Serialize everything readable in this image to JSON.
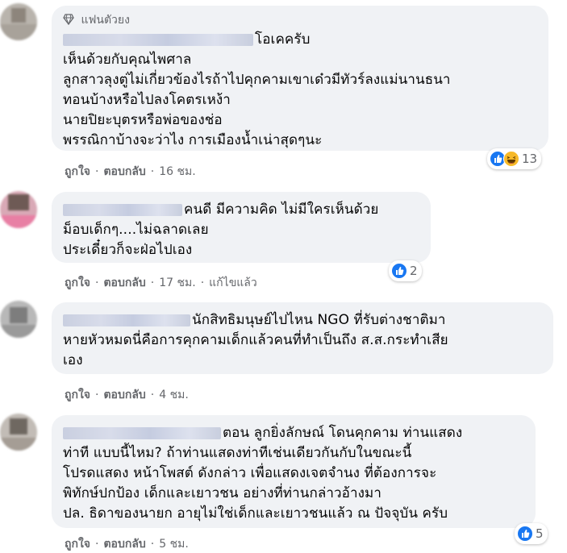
{
  "comments": [
    {
      "badge": "แฟนตัวยง",
      "lines": [
        "โอเคครับ",
        "เห็นด้วยกับคุณไพศาล",
        "ลูกสาวลุงตู่ไม่เกี่ยวข้องไรถ้าไปคุกคามเขาเด๋วมีทัวร์ลงแม่นานธนา",
        "ทอนบ้างหรือไปลงโคตรเหง้า",
        "นายปิยะบุตรหรือพ่อของช่อ",
        "พรรณิกาบ้างจะว่าไง การเมืองน้ำเน่าสุดๆนะ"
      ],
      "actions": {
        "like": "ถูกใจ",
        "reply": "ตอบกลับ",
        "time": "16 ชม."
      },
      "reactions": {
        "icons": [
          "like-icon",
          "haha-icon"
        ],
        "count": "13"
      }
    },
    {
      "lines": [
        "คนดี มีความคิด ไม่มีใครเห็นด้วย",
        "ม็อบเด็กๆ....ไม่ฉลาดเลย",
        "ประเดี๋ยวก็จะฝ่อไปเอง"
      ],
      "actions": {
        "like": "ถูกใจ",
        "reply": "ตอบกลับ",
        "time": "17 ชม.",
        "edited": "แก้ไขแล้ว"
      },
      "reactions": {
        "icons": [
          "like-icon"
        ],
        "count": "2"
      }
    },
    {
      "lines": [
        "นักสิทธิมนุษย์ไปไหน NGO ที่รับต่างชาติมา",
        "หายหัวหมดนี่คือการคุกคามเด็กแล้วคนที่ทำเป็นถึง ส.ส.กระทำเสีย",
        "เอง"
      ],
      "actions": {
        "like": "ถูกใจ",
        "reply": "ตอบกลับ",
        "time": "4 ชม."
      }
    },
    {
      "lines": [
        "ตอน ลูกยิ่งลักษณ์ โดนคุกคาม ท่านแสดง",
        "ท่าที แบบนี้ไหม? ถ้าท่านแสดงท่าทีเช่นเดียวกันกับในขณะนี้",
        "โปรดแสดง หน้าโพสต์ ดังกล่าว เพื่อแสดงเจตจำนง ที่ต้องการจะ",
        "พิทักษ์ปกป้อง เด็กและเยาวชน อย่างที่ท่านกล่าวอ้างมา",
        "ปล. ธิดาของนายก อายุไม่ใช่เด็กและเยาวชนแล้ว ณ ปัจจุบัน ครับ"
      ],
      "actions": {
        "like": "ถูกใจ",
        "reply": "ตอบกลับ",
        "time": "5 ชม."
      },
      "reactions": {
        "icons": [
          "like-icon"
        ],
        "count": "5"
      }
    }
  ],
  "colors": {
    "bubble": "#f0f2f5",
    "meta_text": "#65676b",
    "like_blue": "#1877f2",
    "haha_yellow": "#f7b928"
  }
}
